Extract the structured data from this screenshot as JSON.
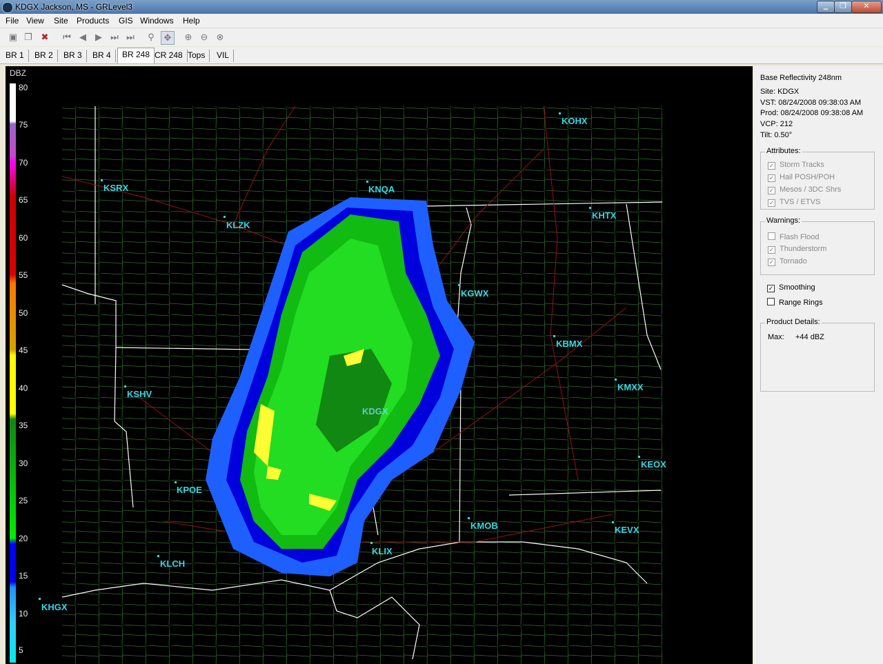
{
  "window": {
    "title": "KDGX Jackson, MS - GRLevel3",
    "min": "‗",
    "max": "❐",
    "close": "✕"
  },
  "menu": [
    "File",
    "View",
    "Site",
    "Products",
    "GIS",
    "Windows",
    "Help"
  ],
  "toolbar_icons": [
    "open-icon",
    "copy-icon",
    "delete-icon",
    "first-frame-icon",
    "prev-frame-icon",
    "play-icon",
    "next-frame-icon",
    "last-frame-icon",
    "zoom-icon",
    "pan-icon",
    "zoom-in-icon",
    "zoom-out-icon",
    "zoom-reset-icon"
  ],
  "tabs": [
    "BR 1",
    "BR 2",
    "BR 3",
    "BR 4",
    "BR 248",
    "CR 248",
    "Tops",
    "VIL"
  ],
  "selected_tab": "BR 248",
  "scale": {
    "title": "DBZ",
    "labels": [
      "80",
      "75",
      "70",
      "65",
      "60",
      "55",
      "50",
      "45",
      "40",
      "35",
      "30",
      "25",
      "20",
      "15",
      "10",
      "5"
    ]
  },
  "stations": [
    {
      "id": "KOHX"
    },
    {
      "id": "KSRX"
    },
    {
      "id": "KNQA"
    },
    {
      "id": "KLZK"
    },
    {
      "id": "KHTX"
    },
    {
      "id": "KGWX"
    },
    {
      "id": "KBMX"
    },
    {
      "id": "KSHV"
    },
    {
      "id": "KDGX"
    },
    {
      "id": "KMXX"
    },
    {
      "id": "KEOX"
    },
    {
      "id": "KPOE"
    },
    {
      "id": "KMOB"
    },
    {
      "id": "KEVX"
    },
    {
      "id": "KLIX"
    },
    {
      "id": "KLCH"
    },
    {
      "id": "KHGX"
    }
  ],
  "panel": {
    "product": "Base Reflectivity 248nm",
    "site": "Site:  KDGX",
    "vst": "VST:  08/24/2008  09:38:03 AM",
    "prod": "Prod: 08/24/2008  09:38:08 AM",
    "vcp": "VCP:  212",
    "tilt": "Tilt:   0.50°",
    "attributes_title": "Attributes:",
    "attributes": [
      "Storm Tracks",
      "Hail POSH/POH",
      "Mesos / 3DC Shrs",
      "TVS / ETVS"
    ],
    "warnings_title": "Warnings:",
    "warnings": [
      "Flash Flood",
      "Thunderstorm",
      "Tornado"
    ],
    "smoothing": "Smoothing",
    "range_rings": "Range Rings",
    "details_title": "Product Details:",
    "max_label": "Max:",
    "max_value": "+44 dBZ"
  }
}
